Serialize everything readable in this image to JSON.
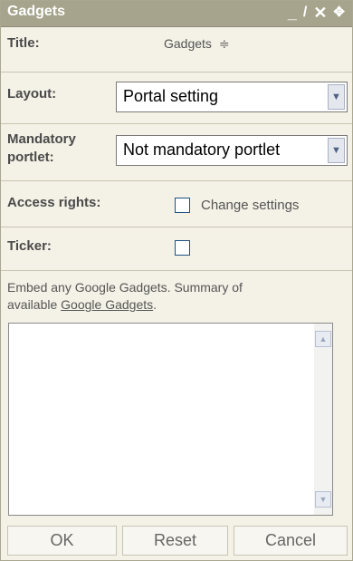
{
  "window": {
    "title": "Gadgets",
    "controls": [
      {
        "name": "minimize-icon",
        "glyph": "_"
      },
      {
        "name": "edit-icon",
        "glyph": "⁄"
      },
      {
        "name": "close-icon",
        "glyph": "✕"
      },
      {
        "name": "move-icon",
        "glyph": "✥"
      }
    ]
  },
  "form": {
    "title_label": "Title:",
    "title_value": "Gadgets",
    "title_sort_icon": "≑",
    "layout_label": "Layout:",
    "layout_value": "Portal setting",
    "mandatory_label_1": "Mandatory",
    "mandatory_label_2": "portlet:",
    "mandatory_value": "Not mandatory portlet",
    "access_label": "Access rights:",
    "access_option": "Change settings",
    "ticker_label": "Ticker:",
    "embed_text_1": "Embed any Google Gadgets. Summary of",
    "embed_text_2": "available",
    "embed_link": "Google Gadgets",
    "embed_text_end": ".",
    "textarea_value": ""
  },
  "buttons": {
    "ok": "OK",
    "reset": "Reset",
    "cancel": "Cancel"
  },
  "colors": {
    "titlebar": "#a6a48c",
    "panel": "#f4f1e6"
  }
}
